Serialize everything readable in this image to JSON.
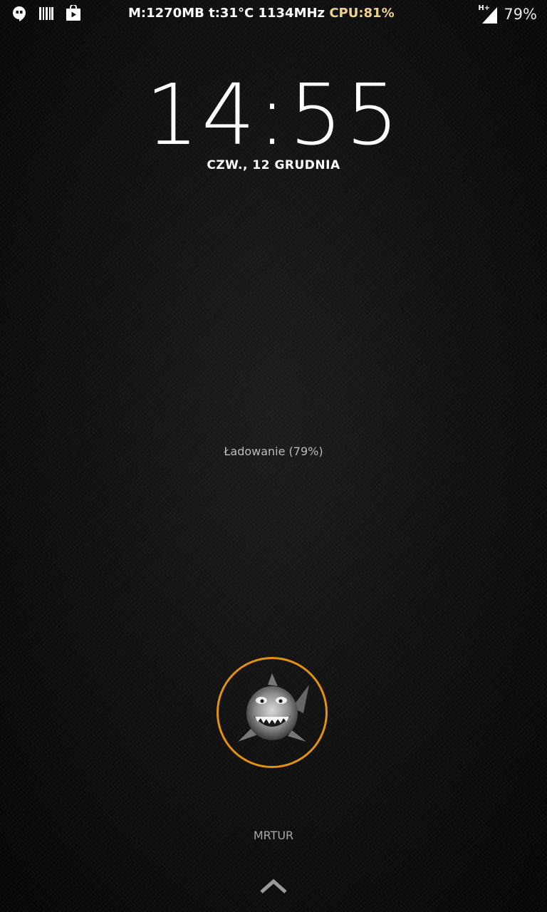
{
  "status_bar": {
    "left_icons": [
      "hangouts-icon",
      "barcode-icon",
      "play-store-icon"
    ],
    "memory": "M:1270MB",
    "temperature": "t:31°C",
    "frequency": "1134MHz",
    "cpu": "CPU:81%",
    "network_type": "H+",
    "battery": "79%",
    "cpu_color": "#f0d28a"
  },
  "lockscreen": {
    "time": "14:55",
    "date": "CZW., 12 GRUDNIA",
    "charging_status": "Ładowanie (79%)",
    "owner_name": "MRTUR",
    "ring_color": "#e3920f",
    "unlock_icon": "chevron-up-icon",
    "avatar_icon": "shark-avatar"
  }
}
